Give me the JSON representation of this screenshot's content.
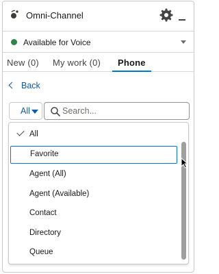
{
  "header": {
    "title": "Omni-Channel",
    "icons": [
      "omni-channel-icon",
      "gear-icon",
      "minimize-icon"
    ]
  },
  "status": {
    "label": "Available for Voice",
    "color": "#2e844a"
  },
  "tabs": [
    {
      "label": "New (0)",
      "active": false
    },
    {
      "label": "My work (0)",
      "active": false
    },
    {
      "label": "Phone",
      "active": true
    }
  ],
  "back": {
    "label": "Back"
  },
  "search": {
    "scope_label": "All",
    "placeholder": "Search..."
  },
  "dropdown": {
    "selected": "All",
    "focused": "Favorite",
    "options": [
      {
        "label": "All"
      },
      {
        "label": "Favorite"
      },
      {
        "label": "Agent (All)"
      },
      {
        "label": "Agent (Available)"
      },
      {
        "label": "Contact"
      },
      {
        "label": "Directory"
      },
      {
        "label": "Queue"
      }
    ]
  },
  "colors": {
    "accent": "#0176d3",
    "link": "#0b5cab",
    "available": "#2e844a"
  }
}
